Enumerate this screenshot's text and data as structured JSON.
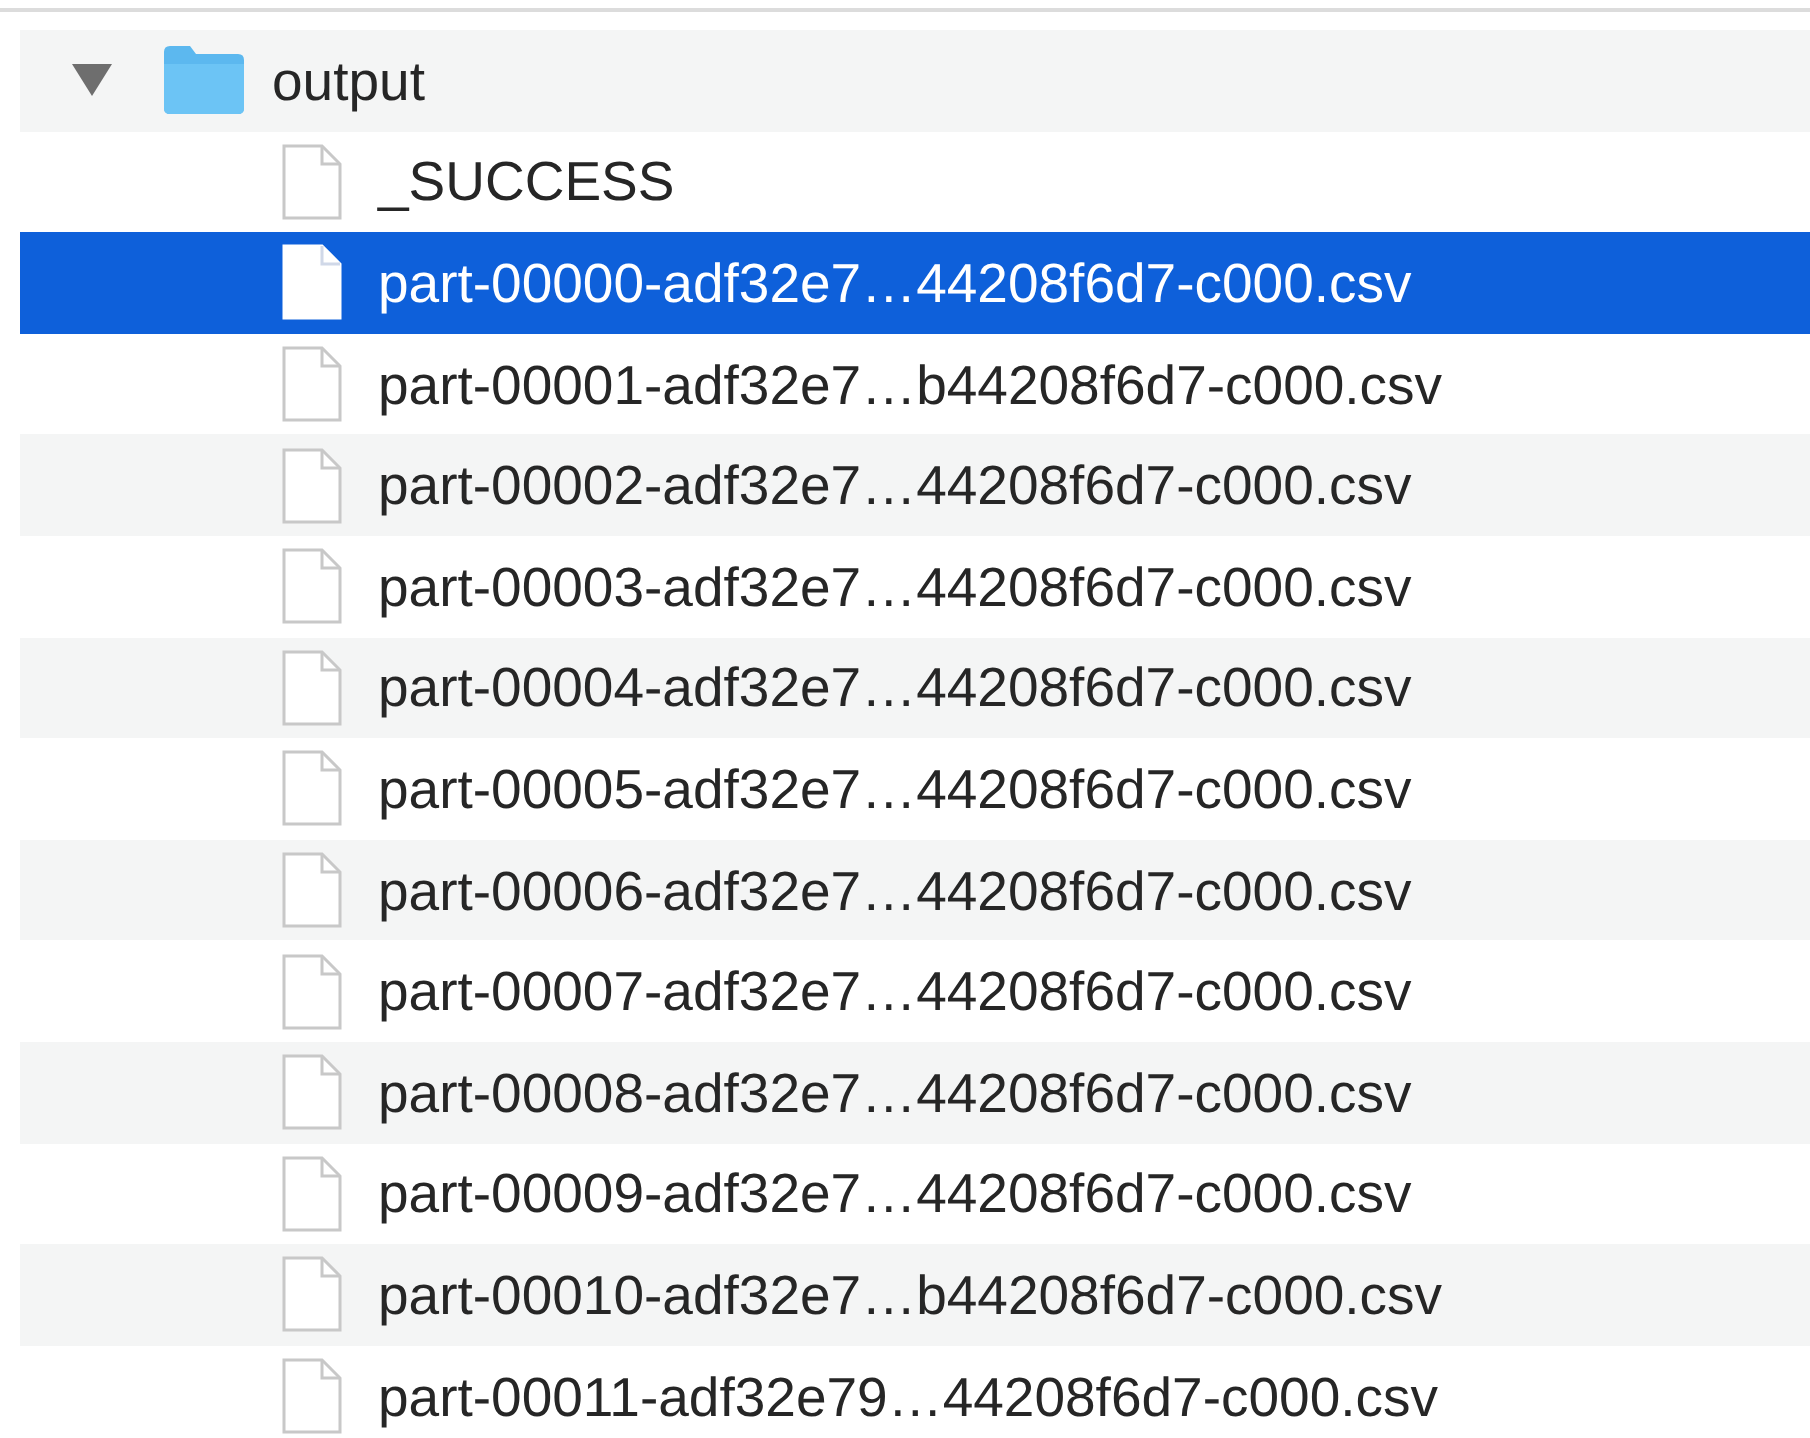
{
  "folder": {
    "name": "output",
    "expanded": true,
    "selected": false,
    "children": [
      {
        "name": "_SUCCESS",
        "selected": false
      },
      {
        "name": "part-00000-adf32e7…44208f6d7-c000.csv",
        "selected": true
      },
      {
        "name": "part-00001-adf32e7…b44208f6d7-c000.csv",
        "selected": false
      },
      {
        "name": "part-00002-adf32e7…44208f6d7-c000.csv",
        "selected": false
      },
      {
        "name": "part-00003-adf32e7…44208f6d7-c000.csv",
        "selected": false
      },
      {
        "name": "part-00004-adf32e7…44208f6d7-c000.csv",
        "selected": false
      },
      {
        "name": "part-00005-adf32e7…44208f6d7-c000.csv",
        "selected": false
      },
      {
        "name": "part-00006-adf32e7…44208f6d7-c000.csv",
        "selected": false
      },
      {
        "name": "part-00007-adf32e7…44208f6d7-c000.csv",
        "selected": false
      },
      {
        "name": "part-00008-adf32e7…44208f6d7-c000.csv",
        "selected": false
      },
      {
        "name": "part-00009-adf32e7…44208f6d7-c000.csv",
        "selected": false
      },
      {
        "name": "part-00010-adf32e7…b44208f6d7-c000.csv",
        "selected": false
      },
      {
        "name": "part-00011-adf32e79…44208f6d7-c000.csv",
        "selected": false
      }
    ]
  }
}
